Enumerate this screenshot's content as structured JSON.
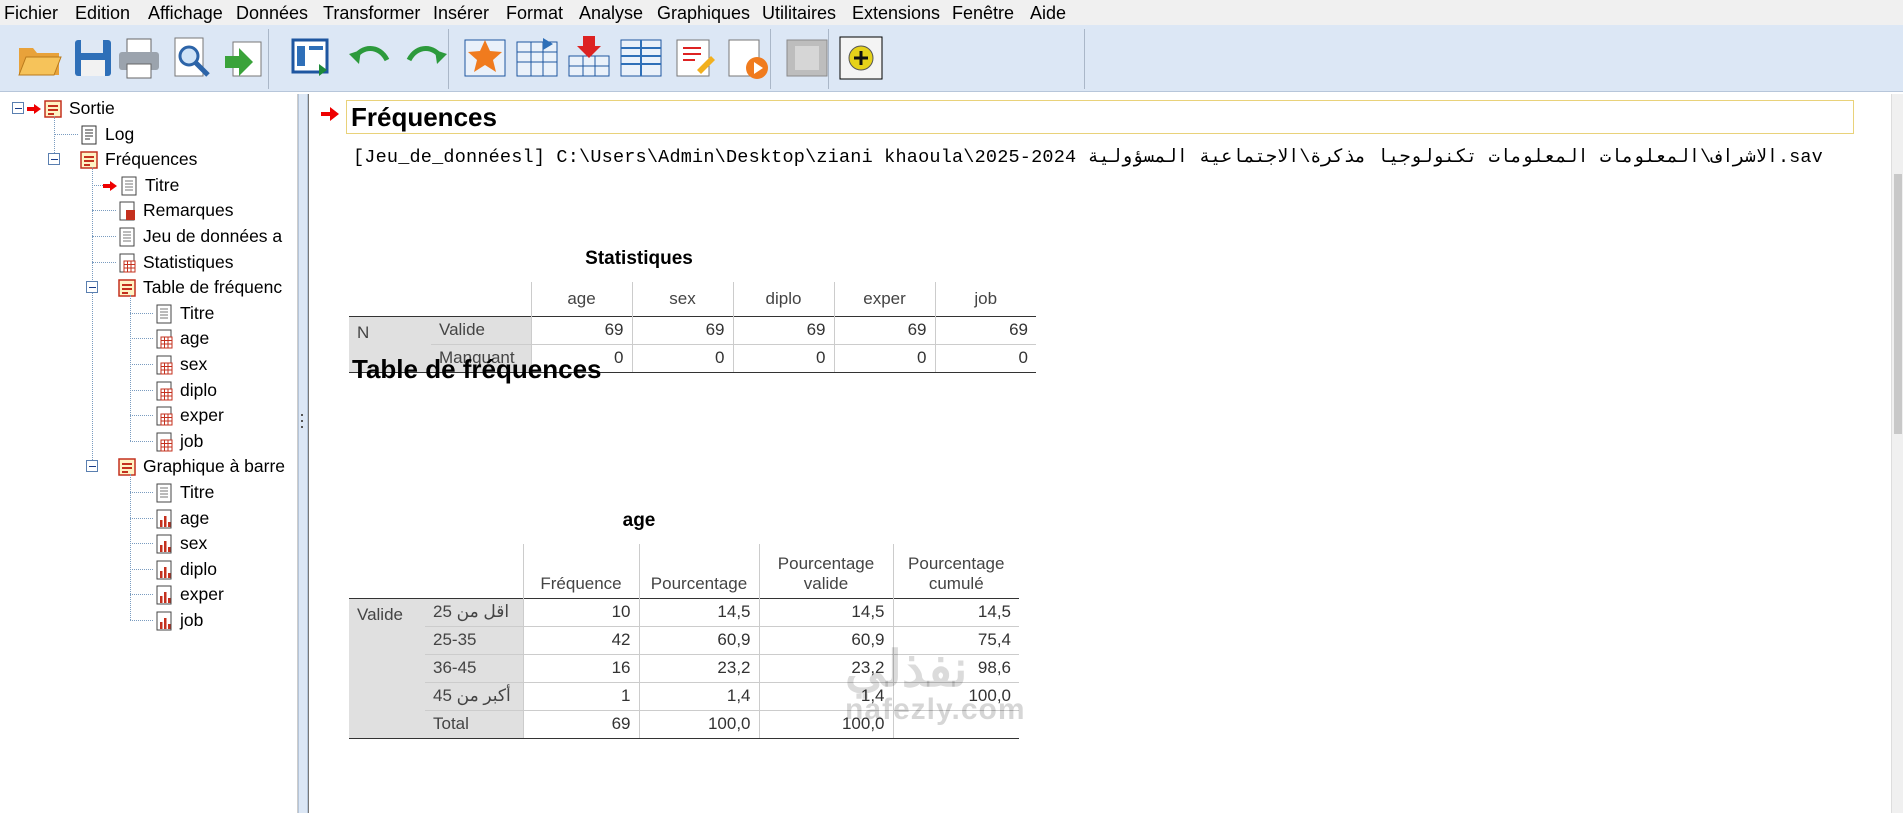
{
  "menu": [
    "Fichier",
    "Edition",
    "Affichage",
    "Données",
    "Transformer",
    "Insérer",
    "Format",
    "Analyse",
    "Graphiques",
    "Utilitaires",
    "Extensions",
    "Fenêtre",
    "Aide"
  ],
  "toolbar_icons": [
    "open-folder-icon",
    "save-icon",
    "print-icon",
    "print-preview-icon",
    "export-icon",
    "recall-dialog-icon",
    "undo-icon",
    "redo-icon",
    "goto-case-icon",
    "goto-variable-icon",
    "insert-cases-icon",
    "variables-icon",
    "designate-window-icon",
    "run-script-icon",
    "disabled-icon",
    "add-icon"
  ],
  "tree": {
    "root": "Sortie",
    "log": "Log",
    "freq": "Fréquences",
    "titre": "Titre",
    "remarques": "Remarques",
    "jeu": "Jeu de données a",
    "statistiques": "Statistiques",
    "table": "Table de fréquenc",
    "table_children": [
      "Titre",
      "age",
      "sex",
      "diplo",
      "exper",
      "job"
    ],
    "graph": "Graphique à barre",
    "graph_children": [
      "Titre",
      "age",
      "sex",
      "diplo",
      "exper",
      "job"
    ]
  },
  "content": {
    "title": "Fréquences",
    "dataset_line": "[Jeu_de_donnéesl] C:\\Users\\Admin\\Desktop\\ziani khaoula\\2025-2024 الاشراف\\المعلومات المعلومات تكنولوجيا مذكرة\\الاجتماعية المسؤولية.sav",
    "stats": {
      "title": "Statistiques",
      "columns": [
        "age",
        "sex",
        "diplo",
        "exper",
        "job"
      ],
      "group": "N",
      "rows": [
        {
          "label": "Valide",
          "values": [
            "69",
            "69",
            "69",
            "69",
            "69"
          ]
        },
        {
          "label": "Manquant",
          "values": [
            "0",
            "0",
            "0",
            "0",
            "0"
          ]
        }
      ]
    },
    "section_title": "Table de fréquences",
    "age": {
      "title": "age",
      "columns": [
        "Fréquence",
        "Pourcentage",
        "Pourcentage valide",
        "Pourcentage cumulé"
      ],
      "group": "Valide",
      "rows": [
        {
          "label": "اقل من 25",
          "values": [
            "10",
            "14,5",
            "14,5",
            "14,5"
          ]
        },
        {
          "label": "25-35",
          "values": [
            "42",
            "60,9",
            "60,9",
            "75,4"
          ]
        },
        {
          "label": "36-45",
          "values": [
            "16",
            "23,2",
            "23,2",
            "98,6"
          ]
        },
        {
          "label": "أكبر من 45",
          "values": [
            "1",
            "1,4",
            "1,4",
            "100,0"
          ]
        },
        {
          "label": "Total",
          "values": [
            "69",
            "100,0",
            "100,0",
            ""
          ]
        }
      ]
    }
  },
  "watermark": {
    "latin": "nafezly.com",
    "arabic": "نفذلي"
  }
}
